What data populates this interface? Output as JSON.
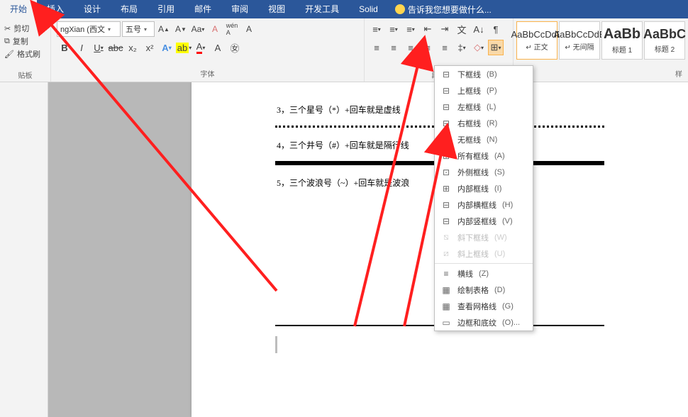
{
  "tabs": [
    "开始",
    "插入",
    "设计",
    "布局",
    "引用",
    "邮件",
    "审阅",
    "视图",
    "开发工具",
    "Solid"
  ],
  "tellme": "告诉我您想要做什么...",
  "clipboard": {
    "cut": "剪切",
    "copy": "复制",
    "painter": "格式刷",
    "label": "贴板"
  },
  "font": {
    "name": "ngXian (西文",
    "size": "五号",
    "buttons": [
      "B",
      "I",
      "U",
      "abc",
      "x₂",
      "x²"
    ],
    "label": "字体"
  },
  "paragraph": {
    "label": "段落"
  },
  "styles": {
    "items": [
      {
        "preview": "AaBbCcDdE",
        "label": "↵ 正文",
        "sel": true
      },
      {
        "preview": "AaBbCcDdE",
        "label": "↵ 无间隔"
      },
      {
        "preview": "AaBb",
        "label": "标题 1",
        "big": true
      },
      {
        "preview": "AaBbC",
        "label": "标题 2",
        "big": true
      }
    ],
    "label": "样"
  },
  "doc": {
    "lines": [
      "3，三个星号（*）+回车就是虚线",
      "4，三个井号（#）+回车就是隔行线",
      "5，三个波浪号（~）+回车就是波浪"
    ]
  },
  "menu": [
    {
      "icon": "⊟",
      "label": "下框线",
      "key": "(B)"
    },
    {
      "icon": "⊟",
      "label": "上框线",
      "key": "(P)"
    },
    {
      "icon": "⊟",
      "label": "左框线",
      "key": "(L)"
    },
    {
      "icon": "⊟",
      "label": "右框线",
      "key": "(R)"
    },
    {
      "icon": "⊞",
      "label": "无框线",
      "key": "(N)"
    },
    {
      "icon": "⊞",
      "label": "所有框线",
      "key": "(A)"
    },
    {
      "icon": "⊡",
      "label": "外侧框线",
      "key": "(S)"
    },
    {
      "icon": "⊞",
      "label": "内部框线",
      "key": "(I)"
    },
    {
      "icon": "⊟",
      "label": "内部横框线",
      "key": "(H)"
    },
    {
      "icon": "⊟",
      "label": "内部竖框线",
      "key": "(V)"
    },
    {
      "icon": "⧅",
      "label": "斜下框线",
      "key": "(W)",
      "disabled": true
    },
    {
      "icon": "⧄",
      "label": "斜上框线",
      "key": "(U)",
      "disabled": true
    },
    {
      "sep": true
    },
    {
      "icon": "≡",
      "label": "横线",
      "key": "(Z)"
    },
    {
      "icon": "▦",
      "label": "绘制表格",
      "key": "(D)"
    },
    {
      "icon": "▦",
      "label": "查看网格线",
      "key": "(G)"
    },
    {
      "icon": "▭",
      "label": "边框和底纹",
      "key": "(O)..."
    }
  ]
}
